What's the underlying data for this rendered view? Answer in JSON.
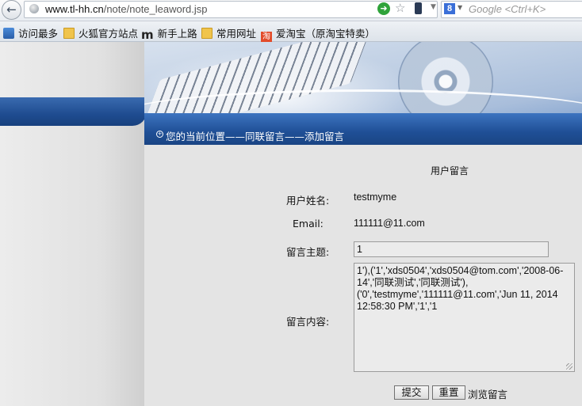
{
  "browser": {
    "url_domain": "www.tl-hh.cn",
    "url_path": "/note/note_leaword.jsp",
    "search_placeholder": "Google <Ctrl+K>",
    "back_glyph": "←",
    "go_glyph": "➜",
    "star_glyph": "☆",
    "reload_glyph": "C",
    "google_glyph": "8"
  },
  "bookmarks": [
    {
      "label": "访问最多",
      "icon": "visit-icon"
    },
    {
      "label": "火狐官方站点",
      "icon": "folder-icon"
    },
    {
      "label": "新手上路",
      "icon": "m-logo-icon"
    },
    {
      "label": "常用网址",
      "icon": "folder-icon"
    },
    {
      "label": "爱淘宝（原淘宝特卖）",
      "icon": "taobao-icon"
    }
  ],
  "bookmark_glyphs": {
    "m": "m",
    "tao": "淘"
  },
  "location": {
    "icon_glyph": "+",
    "text": "您的当前位置——同联留言——添加留言"
  },
  "form": {
    "title": "用户留言",
    "username_label": "用户姓名:",
    "username_value": "testmyme",
    "email_label": "Email:",
    "email_value": "111111@11.com",
    "subject_label": "留言主题:",
    "subject_value": "1",
    "content_label": "留言内容:",
    "content_value": "1'),('1','xds0504','xds0504@tom.com','2008-06-14','同联测试','同联测试'),\n('0','testmyme','111111@11.com','Jun 11, 2014 12:58:30 PM','1','1",
    "submit_label": "提交",
    "reset_label": "重置",
    "browse_label": "浏览留言"
  },
  "colors": {
    "banner_blue": "#1f4f96",
    "page_bg": "#e4e4e4"
  }
}
